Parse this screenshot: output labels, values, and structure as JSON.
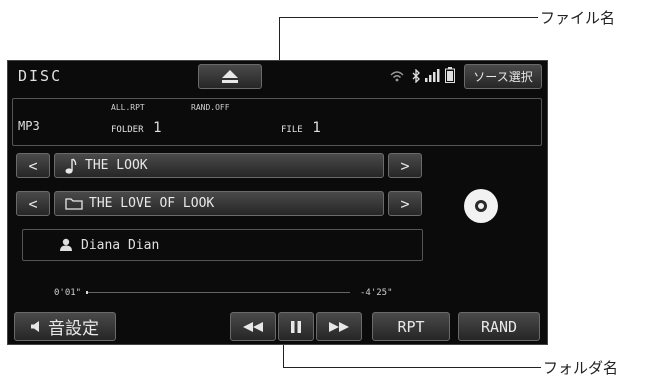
{
  "callouts": {
    "top": "ファイル名",
    "bottom": "フォルダ名"
  },
  "status": {
    "source": "DISC",
    "source_select": "ソース選択",
    "format": "MP3",
    "repeat_mode": "ALL.RPT",
    "random_mode": "RAND.OFF",
    "folder_label": "FOLDER",
    "folder_num": "1",
    "file_label": "FILE",
    "file_num": "1"
  },
  "track": {
    "title": "THE LOOK",
    "folder": "THE LOVE OF LOOK",
    "artist": "Diana Dian"
  },
  "progress": {
    "elapsed": "0'01\"",
    "remaining": "-4'25\"",
    "fraction": 0.004
  },
  "controls": {
    "sound_settings": "音設定",
    "rpt": "RPT",
    "rand": "RAND"
  },
  "icons": {
    "eject": "eject-icon",
    "wifi": "wifi-icon",
    "bluetooth": "bluetooth-icon",
    "signal": "signal-icon",
    "battery": "battery-icon",
    "note": "music-note-icon",
    "folder": "folder-icon",
    "artist": "person-icon",
    "disc": "disc-icon",
    "speaker": "speaker-icon",
    "rewind": "rewind-icon",
    "pause": "pause-icon",
    "forward": "fast-forward-icon"
  }
}
